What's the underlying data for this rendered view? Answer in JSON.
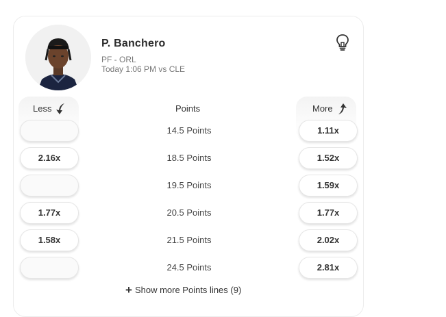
{
  "player": {
    "name": "P. Banchero",
    "position_team": "PF - ORL",
    "game_time": "Today 1:06 PM vs CLE"
  },
  "columns": {
    "less_label": "Less",
    "points_label": "Points",
    "more_label": "More"
  },
  "lines": [
    {
      "label": "14.5 Points",
      "less": "",
      "more": "1.11x"
    },
    {
      "label": "18.5 Points",
      "less": "2.16x",
      "more": "1.52x"
    },
    {
      "label": "19.5 Points",
      "less": "",
      "more": "1.59x"
    },
    {
      "label": "20.5 Points",
      "less": "1.77x",
      "more": "1.77x"
    },
    {
      "label": "21.5 Points",
      "less": "1.58x",
      "more": "2.02x"
    },
    {
      "label": "24.5 Points",
      "less": "",
      "more": "2.81x"
    }
  ],
  "show_more": {
    "icon": "+",
    "label": "Show more Points lines (9)"
  },
  "icons": {
    "insight": "lightbulb-icon",
    "less": "arrow-down-left-icon",
    "more": "arrow-up-right-icon"
  }
}
